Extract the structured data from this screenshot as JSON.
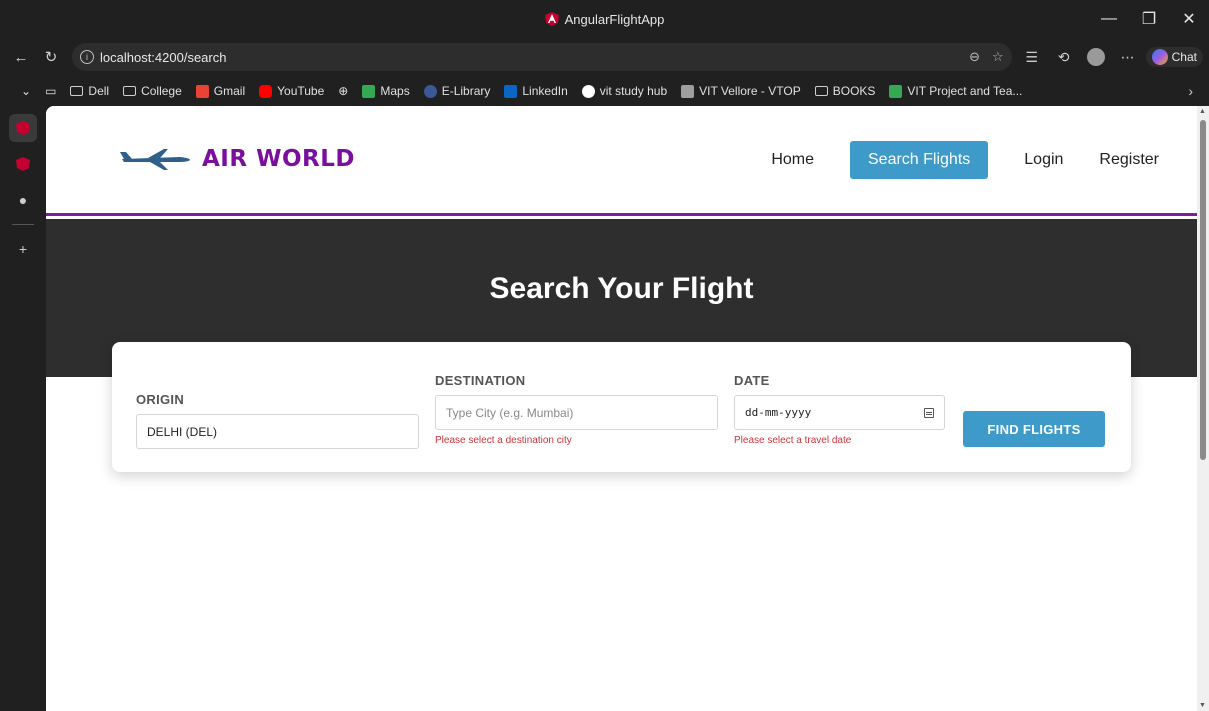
{
  "window": {
    "title": "AngularFlightApp",
    "controls": [
      "—",
      "❐",
      "✕"
    ]
  },
  "browser": {
    "url": "localhost:4200/search",
    "chat_label": "Chat"
  },
  "bookmarks": [
    {
      "label": "Dell",
      "kind": "folder"
    },
    {
      "label": "College",
      "kind": "folder"
    },
    {
      "label": "Gmail",
      "kind": "site",
      "color": "#ea4335"
    },
    {
      "label": "YouTube",
      "kind": "site",
      "color": "#ff0000"
    },
    {
      "label": "",
      "kind": "globe"
    },
    {
      "label": "Maps",
      "kind": "site",
      "color": "#34a853"
    },
    {
      "label": "E-Library",
      "kind": "site",
      "color": "#3b5998"
    },
    {
      "label": "LinkedIn",
      "kind": "site",
      "color": "#0a66c2"
    },
    {
      "label": "vit study hub",
      "kind": "site",
      "color": "#ffffff"
    },
    {
      "label": "VIT Vellore - VTOP",
      "kind": "site",
      "color": "#9e9e9e"
    },
    {
      "label": "BOOKS",
      "kind": "folder"
    },
    {
      "label": "VIT Project and Tea...",
      "kind": "site",
      "color": "#34a853"
    }
  ],
  "site": {
    "brand": "AIR WORLD",
    "nav": {
      "home": "Home",
      "search": "Search Flights",
      "login": "Login",
      "register": "Register"
    },
    "hero_title": "Search Your Flight",
    "form": {
      "origin_label": "ORIGIN",
      "origin_value": "DELHI (DEL)",
      "destination_label": "DESTINATION",
      "destination_placeholder": "Type City (e.g. Mumbai)",
      "destination_error": "Please select a destination city",
      "date_label": "DATE",
      "date_placeholder": "dd-mm-yyyy",
      "date_error": "Please select a travel date",
      "submit_label": "FIND FLIGHTS"
    }
  },
  "colors": {
    "brand_purple": "#7a0f9e",
    "accent_blue": "#3d9ac9",
    "error_red": "#d0343b",
    "hero_bg": "#2e2e2e"
  }
}
